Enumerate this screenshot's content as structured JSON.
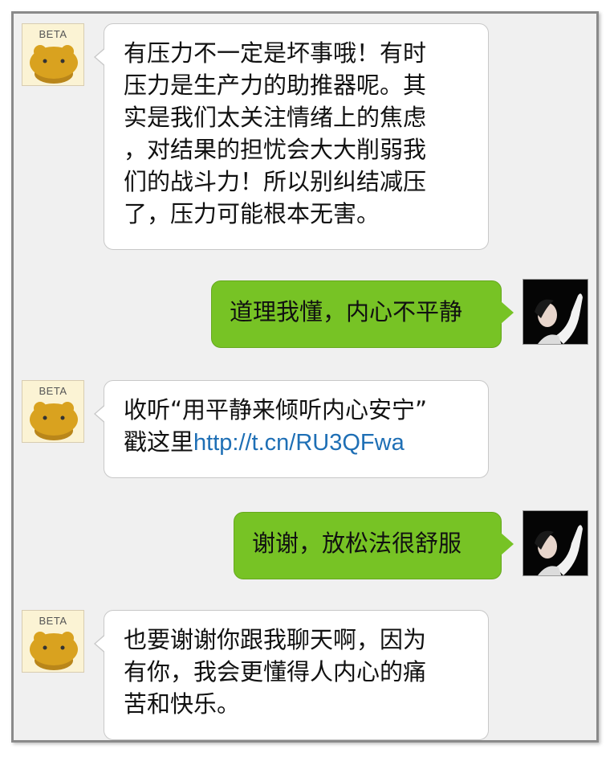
{
  "chat": {
    "bot_avatar_label": "BETA",
    "messages": [
      {
        "sender": "bot",
        "lines": [
          "有压力不一定是坏事哦！有时",
          "压力是生产力的助推器呢。其",
          "实是我们太关注情绪上的焦虑",
          "，对结果的担忧会大大削弱我",
          "们的战斗力！所以别纠结减压",
          "了，压力可能根本无害。"
        ]
      },
      {
        "sender": "user",
        "text": "道理我懂，内心不平静"
      },
      {
        "sender": "bot",
        "line1": "收听“用平静来倾听内心安宁”",
        "line2_prefix": "戳这里",
        "link": "http://t.cn/RU3QFwa"
      },
      {
        "sender": "user",
        "text": "谢谢，放松法很舒服"
      },
      {
        "sender": "bot",
        "lines": [
          "也要谢谢你跟我聊天啊，因为",
          "有你，我会更懂得人内心的痛",
          "苦和快乐。"
        ]
      }
    ]
  },
  "colors": {
    "user_bubble": "#77c325",
    "bot_bubble": "#ffffff",
    "link": "#1e6fb5",
    "background": "#f0f0f0"
  },
  "icons": {
    "bot_avatar": "beta-bear-avatar-icon",
    "user_avatar": "user-photo-avatar-icon"
  }
}
